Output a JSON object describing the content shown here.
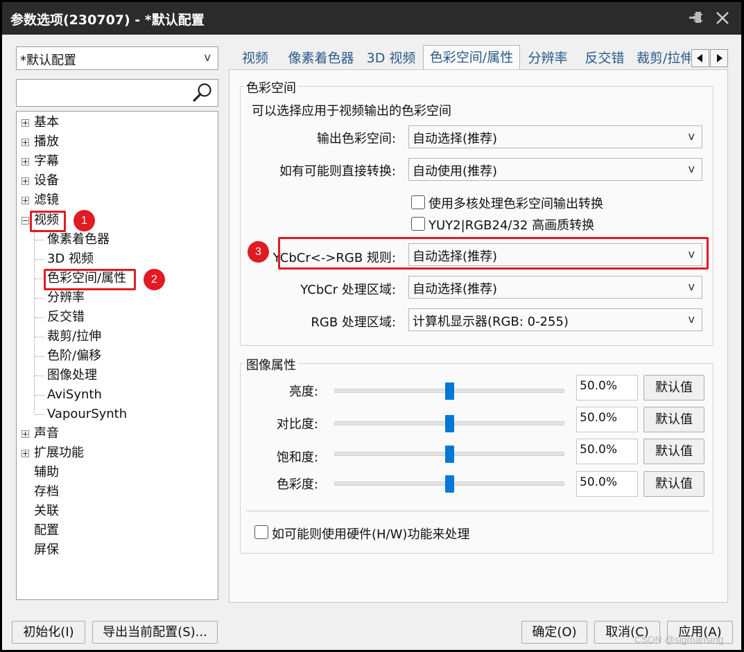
{
  "window": {
    "title": "参数选项(230707) - *默认配置"
  },
  "profile": {
    "selected": "*默认配置",
    "caret": "v"
  },
  "search": {
    "value": ""
  },
  "tree": {
    "items": [
      {
        "label": "基本"
      },
      {
        "label": "播放"
      },
      {
        "label": "字幕"
      },
      {
        "label": "设备"
      },
      {
        "label": "滤镜"
      },
      {
        "label": "视频"
      },
      {
        "label": "像素着色器"
      },
      {
        "label": "3D 视频"
      },
      {
        "label": "色彩空间/属性"
      },
      {
        "label": "分辨率"
      },
      {
        "label": "反交错"
      },
      {
        "label": "裁剪/拉伸"
      },
      {
        "label": "色阶/偏移"
      },
      {
        "label": "图像处理"
      },
      {
        "label": "AviSynth"
      },
      {
        "label": "VapourSynth"
      },
      {
        "label": "声音"
      },
      {
        "label": "扩展功能"
      },
      {
        "label": "辅助"
      },
      {
        "label": "存档"
      },
      {
        "label": "关联"
      },
      {
        "label": "配置"
      },
      {
        "label": "屏保"
      }
    ]
  },
  "annotations": {
    "badge1": "1",
    "badge2": "2",
    "badge3": "3",
    "highlight_color": "#e01b24"
  },
  "tabs": [
    {
      "label": "视频"
    },
    {
      "label": "像素着色器"
    },
    {
      "label": "3D 视频"
    },
    {
      "label": "色彩空间/属性"
    },
    {
      "label": "分辨率"
    },
    {
      "label": "反交错"
    },
    {
      "label": "裁剪/拉伸"
    }
  ],
  "colorspace": {
    "group_title": "色彩空间",
    "description": "可以选择应用于视频输出的色彩空间",
    "output_label": "输出色彩空间:",
    "output_value": "自动选择(推荐)",
    "direct_label": "如有可能则直接转换:",
    "direct_value": "自动使用(推荐)",
    "multicore_label": "使用多核处理色彩空间输出转换",
    "multicore_checked": false,
    "hq_label": "YUY2|RGB24/32 高画质转换",
    "hq_checked": false,
    "rule_label": "YCbCr<->RGB 规则:",
    "rule_value": "自动选择(推荐)",
    "ycbcr_range_label": "YCbCr 处理区域:",
    "ycbcr_range_value": "自动选择(推荐)",
    "rgb_range_label": "RGB 处理区域:",
    "rgb_range_value": "计算机显示器(RGB: 0-255)",
    "caret": "v"
  },
  "image": {
    "group_title": "图像属性",
    "rows": [
      {
        "label": "亮度:",
        "value": "50.0%",
        "level": 0.5,
        "reset": "默认值"
      },
      {
        "label": "对比度:",
        "value": "50.0%",
        "level": 0.5,
        "reset": "默认值"
      },
      {
        "label": "饱和度:",
        "value": "50.0%",
        "level": 0.5,
        "reset": "默认值"
      },
      {
        "label": "色彩度:",
        "value": "50.0%",
        "level": 0.5,
        "reset": "默认值"
      }
    ],
    "hw_label": "如可能则使用硬件(H/W)功能来处理",
    "hw_checked": false
  },
  "footer": {
    "init": "初始化(I)",
    "export": "导出当前配置(S)...",
    "ok": "确定(O)",
    "cancel": "取消(C)",
    "apply": "应用(A)"
  },
  "watermark": "CSDN @sigmarising",
  "colors": {
    "accent": "#0078d7",
    "tab_text": "#2a5a8a",
    "titlebar": "#2b2b2b"
  }
}
